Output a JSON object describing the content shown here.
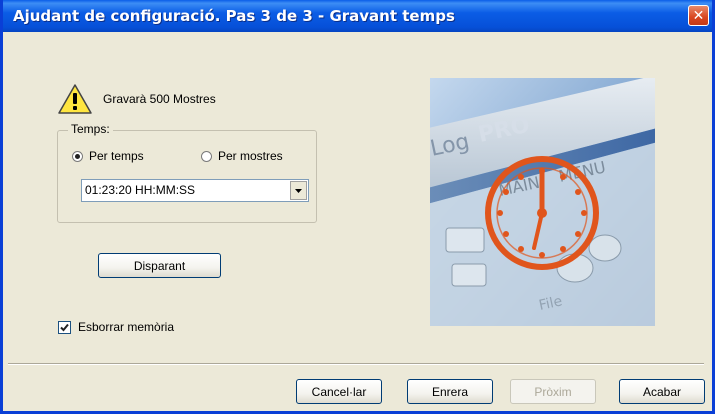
{
  "window": {
    "title": "Ajudant de configuració. Pas 3 de 3 - Gravant temps",
    "close_icon": "close-icon"
  },
  "info": {
    "icon": "warning-icon",
    "text": "Gravarà 500 Mostres"
  },
  "time_group": {
    "legend": "Temps:",
    "radio_by_time": {
      "label": "Per temps",
      "checked": true
    },
    "radio_by_samples": {
      "label": "Per mostres",
      "checked": false
    },
    "duration_select": {
      "value": "01:23:20 HH:MM:SS"
    }
  },
  "trigger_button": {
    "label": "Disparant"
  },
  "erase_memory": {
    "label": "Esborrar memòria",
    "checked": true
  },
  "image": {
    "logo_text": "LogPRO",
    "display_words": [
      "MAIN",
      "MENU",
      "File"
    ]
  },
  "footer": {
    "cancel_label": "Cancel·lar",
    "back_label": "Enrera",
    "next_label": "Pròxim",
    "finish_label": "Acabar"
  },
  "colors": {
    "titlebar": "#0a5ee8",
    "dialog_bg": "#ece9d8",
    "close": "#d9461f",
    "clock": "#e0551c"
  }
}
